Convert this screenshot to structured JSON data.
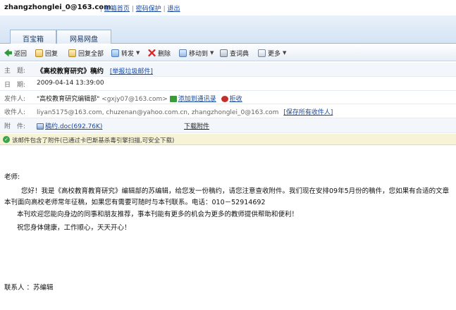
{
  "topbar": {
    "user": "zhangzhonglei_0@163.com",
    "sep1": "|",
    "mail_home": "邮箱首页",
    "sep2": "|",
    "password": "密码保护",
    "sep3": "|",
    "logout": "退出"
  },
  "tabs": [
    {
      "label": "百宝箱"
    },
    {
      "label": "网易网盘"
    }
  ],
  "toolbar": {
    "back": "返回",
    "reply": "回复",
    "reply_all": "回复全部",
    "forward": "转发",
    "delete": "删除",
    "move": "移动到",
    "dict": "查词典",
    "more": "更多"
  },
  "header": {
    "subject_label": "主　题:",
    "subject": "《高校教育研究》稿约",
    "report_spam": "[举报垃圾邮件]",
    "date_label": "日　期:",
    "date": "2009-04-14 13:39:00",
    "from_label": "发件人:",
    "from_name": "\"高校教育研究编辑部\"",
    "from_addr": "<gxjy07@163.com>",
    "add_contact": "添加到通讯录",
    "reject": "拒收",
    "to_label": "收件人:",
    "to_list": "liyan5175@163.com, chuzenan@yahoo.com.cn, zhangzhonglei_0@163.com",
    "save_all": "[保存所有收件人]",
    "attach_label": "附　件:",
    "attachment": "稿约.doc(692.76K)",
    "download": "下载附件"
  },
  "safe_notice": "该邮件包含了附件(已通过卡巴斯基杀毒引擎扫描,可安全下载)",
  "body": {
    "greeting": "老师:",
    "line1": "您好！我是《高校教育教育研究》编辑部的苏编辑，给您发一份稿约，请您注意查收附件。我们现在安排09年5月份的稿件，您如果有合适的文章",
    "line2": "本刊面向高校老师常年征稿，如果您有需要可随时与本刊联系。电话：010－52914692",
    "line3": "本刊欢迎您能向身边的同事和朋友推荐，事本刊能有更多的机会为更多的教师提供帮助和便利！",
    "line4": "祝您身体健康，工作顺心，天天开心！",
    "signature": "联系人 ：苏编辑"
  }
}
